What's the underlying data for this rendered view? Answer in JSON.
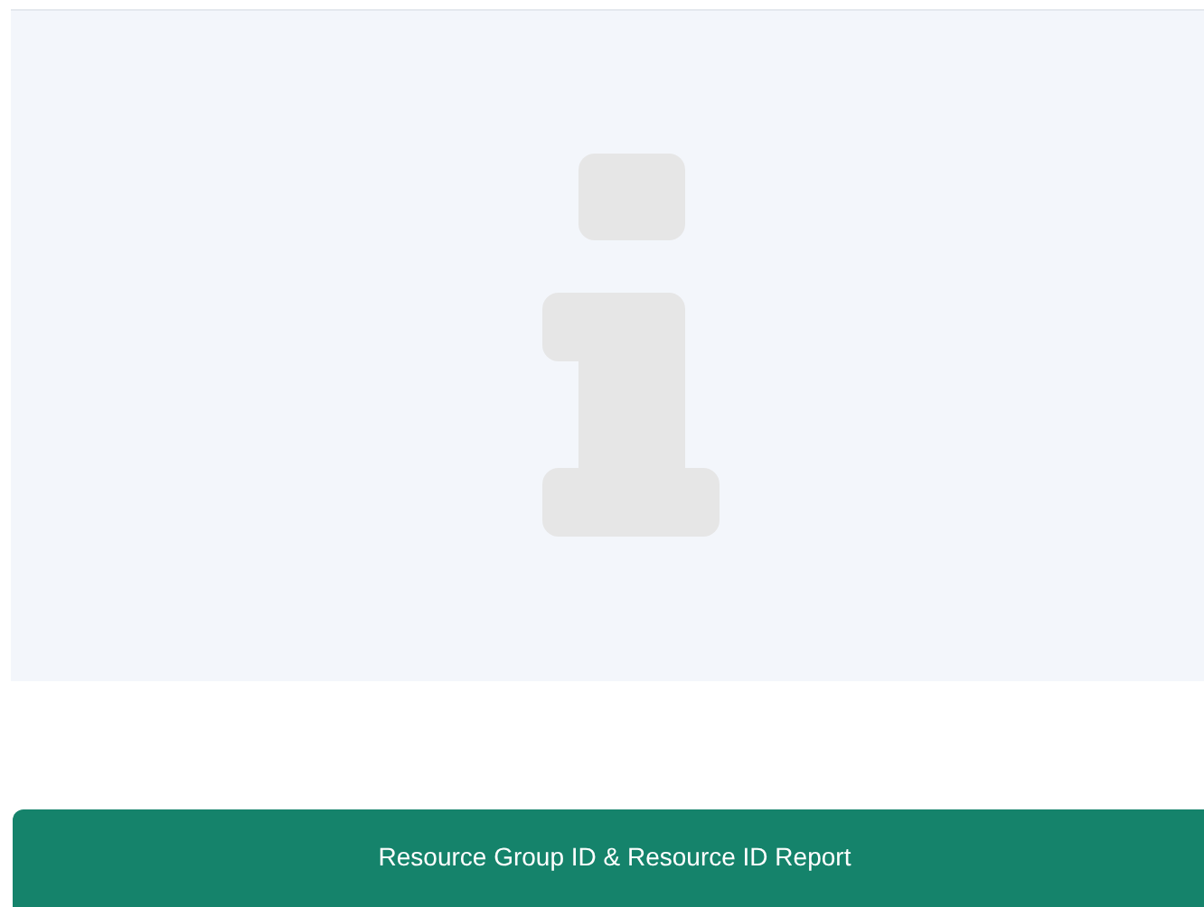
{
  "report_button": {
    "label": "Resource Group ID & Resource ID Report"
  }
}
